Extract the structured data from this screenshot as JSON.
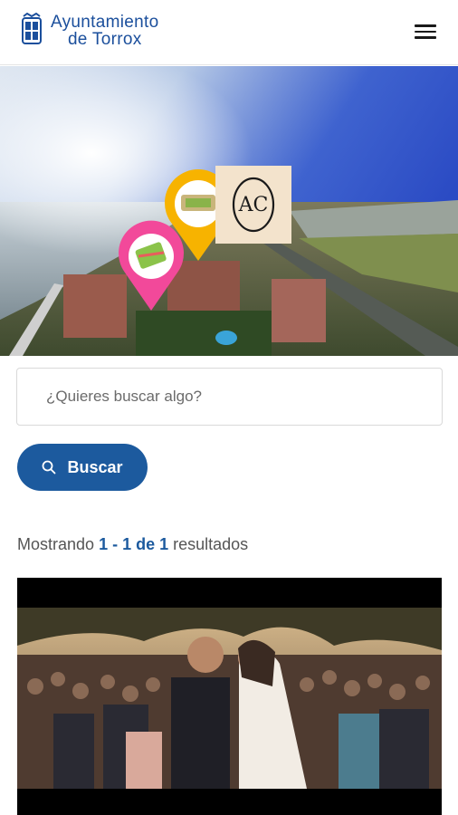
{
  "header": {
    "logo_line1": "Ayuntamiento",
    "logo_line2": "de Torrox",
    "brand_color": "#1b4f9c",
    "menu_icon": "hamburger-menu-icon"
  },
  "hero": {
    "pins": [
      {
        "color": "#f2499a",
        "icon": "map-pin-icon"
      },
      {
        "color": "#f7b300",
        "icon": "map-pin-icon"
      }
    ],
    "badge_letters": "AC"
  },
  "search": {
    "placeholder": "¿Quieres buscar algo?",
    "button_label": "Buscar",
    "button_color": "#1c5a9e"
  },
  "results": {
    "prefix": "Mostrando",
    "range": "1 - 1 de 1",
    "suffix": "resultados"
  }
}
